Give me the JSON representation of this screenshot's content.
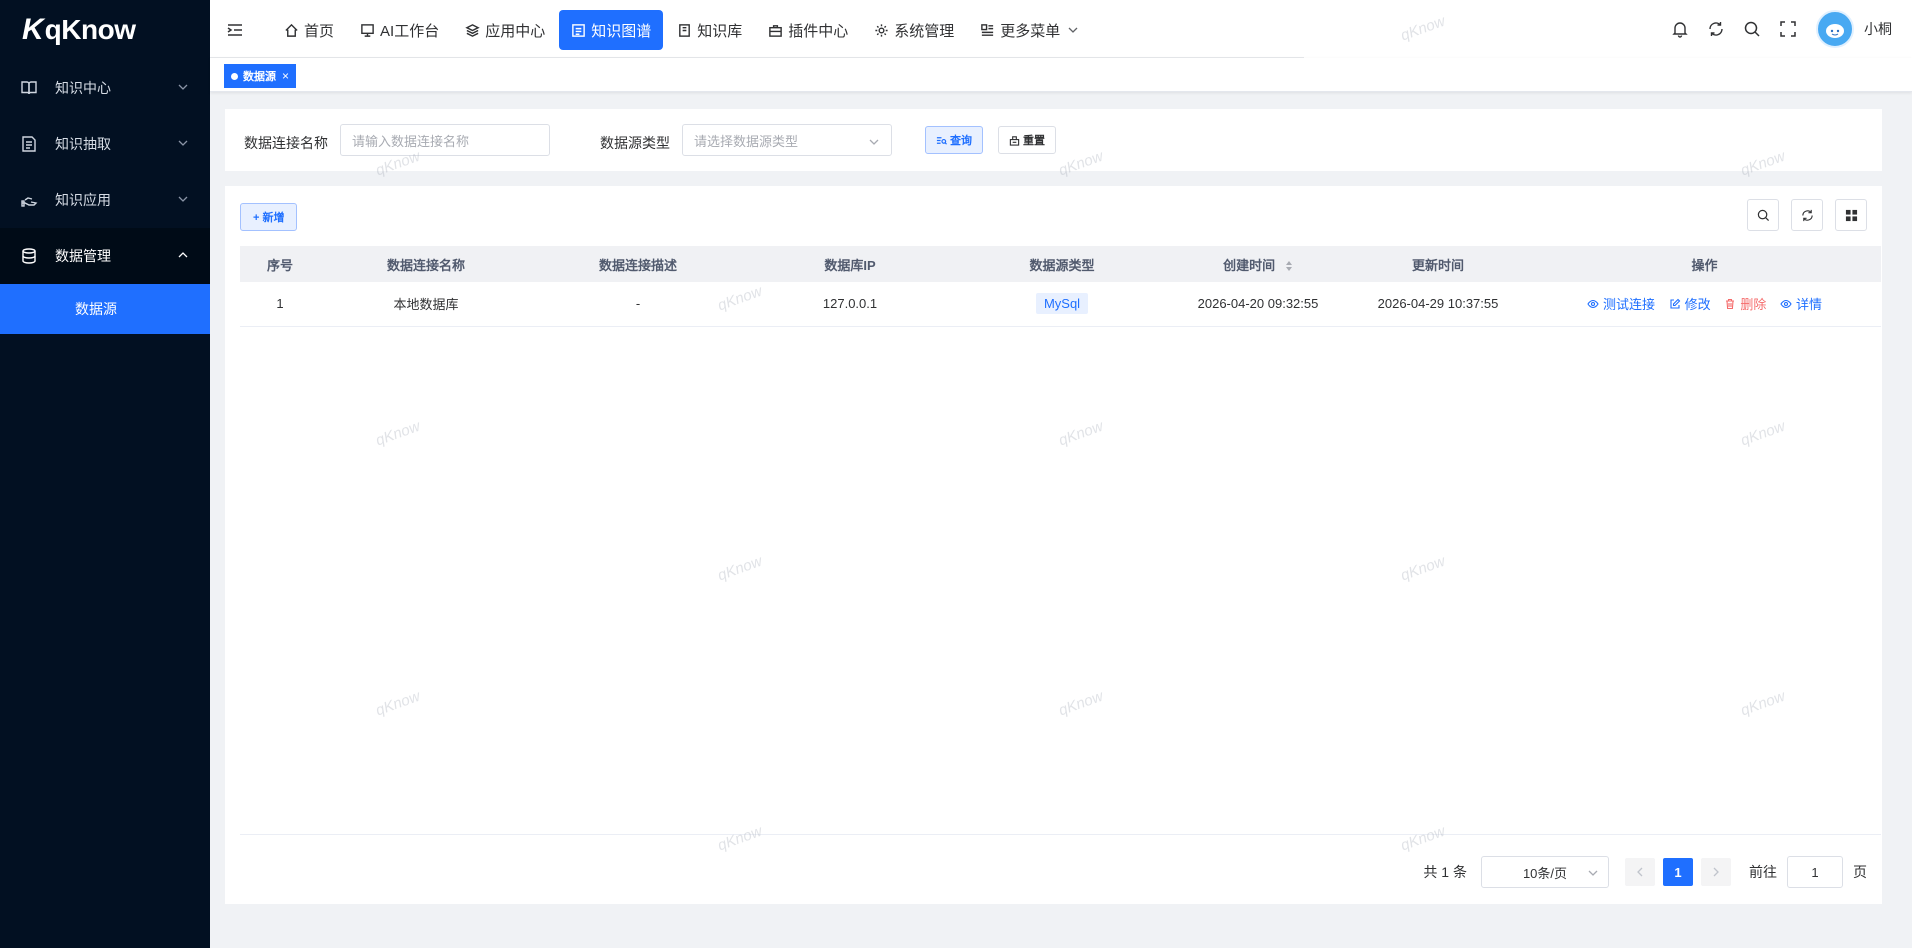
{
  "app": {
    "logo_mark": "K",
    "logo_text": "qKnow"
  },
  "sidebar": {
    "items": [
      {
        "label": "知识中心",
        "icon": "book-icon"
      },
      {
        "label": "知识抽取",
        "icon": "document-icon"
      },
      {
        "label": "知识应用",
        "icon": "hand-icon"
      },
      {
        "label": "数据管理",
        "icon": "database-icon"
      }
    ],
    "sub_active": "数据源"
  },
  "topnav": {
    "items": [
      {
        "label": "首页",
        "icon": "home-icon"
      },
      {
        "label": "AI工作台",
        "icon": "monitor-icon"
      },
      {
        "label": "应用中心",
        "icon": "layers-icon"
      },
      {
        "label": "知识图谱",
        "icon": "graph-icon",
        "active": true
      },
      {
        "label": "知识库",
        "icon": "book-icon"
      },
      {
        "label": "插件中心",
        "icon": "plugin-icon"
      },
      {
        "label": "系统管理",
        "icon": "gear-icon"
      },
      {
        "label": "更多菜单",
        "icon": "grid-icon"
      }
    ],
    "user": "小桐"
  },
  "tags": {
    "active": "数据源",
    "close": "×"
  },
  "search": {
    "name_label": "数据连接名称",
    "name_placeholder": "请输入数据连接名称",
    "type_label": "数据源类型",
    "type_placeholder": "请选择数据源类型",
    "query_label": "查询",
    "reset_label": "重置"
  },
  "toolbar": {
    "add_label": "+ 新增"
  },
  "table": {
    "headers": [
      "序号",
      "数据连接名称",
      "数据连接描述",
      "数据库IP",
      "数据源类型",
      "创建时间",
      "更新时间",
      "操作"
    ],
    "rows": [
      {
        "index": "1",
        "name": "本地数据库",
        "desc": "-",
        "ip": "127.0.0.1",
        "type": "MySql",
        "created": "2026-04-20 09:32:55",
        "updated": "2026-04-29 10:37:55"
      }
    ],
    "actions": {
      "test": "测试连接",
      "edit": "修改",
      "delete": "删除",
      "detail": "详情"
    }
  },
  "pagination": {
    "total": "共 1 条",
    "page_size": "10条/页",
    "current": "1",
    "goto_label": "前往",
    "goto_value": "1",
    "page_suffix": "页"
  },
  "watermark": "qKnow",
  "colors": {
    "primary": "#1f6fff",
    "sidebar_bg": "#021022",
    "danger": "#f56c6c"
  }
}
